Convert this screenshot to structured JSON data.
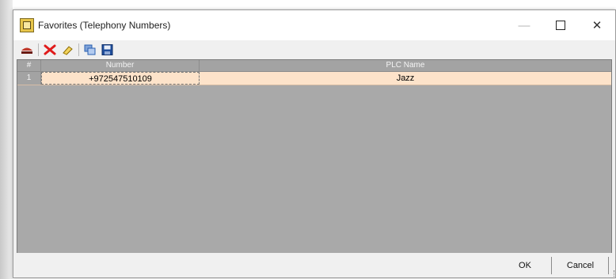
{
  "window": {
    "title": "Favorites (Telephony Numbers)"
  },
  "titlebar_buttons": {
    "minimize": "—",
    "close": "✕"
  },
  "toolbar": {
    "items": [
      {
        "icon": "dial-icon",
        "color": "#c0392b"
      },
      {
        "icon": "delete-icon",
        "color": "#e01b1b"
      },
      {
        "icon": "eraser-icon",
        "color": "#d4a017"
      },
      {
        "icon": "copy-icon",
        "color": "#2a5fb0"
      },
      {
        "icon": "save-icon",
        "color": "#1f4e9c"
      }
    ]
  },
  "grid": {
    "columns": [
      "#",
      "Number",
      "PLC Name"
    ],
    "rows": [
      {
        "index": "1",
        "number": "+972547510109",
        "plc_name": "Jazz"
      }
    ],
    "selected_row_color": "#fde3ca",
    "background_color": "#a9a9a9"
  },
  "footer": {
    "ok_label": "OK",
    "cancel_label": "Cancel"
  }
}
